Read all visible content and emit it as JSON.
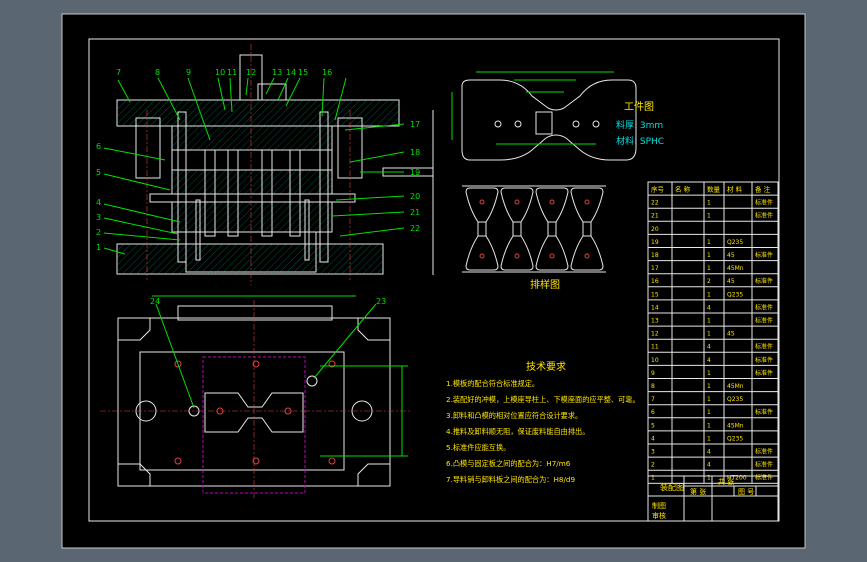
{
  "drawing": {
    "part_numbers_top": [
      "7",
      "8",
      "9",
      "10",
      "11",
      "12",
      "13",
      "14",
      "15",
      "16"
    ],
    "part_numbers_left": [
      "6",
      "5",
      "4",
      "3",
      "2",
      "1"
    ],
    "part_numbers_right": [
      "17",
      "18",
      "19",
      "20",
      "21",
      "22"
    ],
    "plan_view_labels": [
      "24",
      "23"
    ],
    "workpiece_title": "工件图",
    "workpiece_thickness": "料厚: 3mm",
    "workpiece_material": "材料: SPHC",
    "strip_layout_title": "排样图"
  },
  "tech_requirements": {
    "title": "技术要求",
    "lines": [
      "1.模板的配合符合标准规定。",
      "2.装配好的冲模，上模座导柱上、下模座面的应平整、可靠。",
      "3.卸料和凸模的相对位置应符合设计要求。",
      "4.推料及卸料顺无阻，保证废料能自由排出。",
      "5.标准件应能互换。",
      "6.凸模与固定板之间的配合为：H7/m6",
      "7.导料销与卸料板之间的配合为：H8/d9"
    ]
  },
  "title_block": {
    "drawing_name": "装配图",
    "cells": [
      "共 张",
      "第 张",
      "图 号",
      "制图",
      "审核"
    ]
  },
  "bom": {
    "headers": [
      "序号",
      "名 称",
      "数量",
      "材 料",
      "备 注"
    ],
    "rows": [
      [
        "22",
        "",
        "1",
        "",
        "标准件"
      ],
      [
        "21",
        "",
        "1",
        "",
        "标准件"
      ],
      [
        "20",
        "",
        "",
        "",
        ""
      ],
      [
        "19",
        "",
        "1",
        "Q235",
        ""
      ],
      [
        "18",
        "",
        "1",
        "45",
        "标准件"
      ],
      [
        "17",
        "",
        "1",
        "45Mn",
        ""
      ],
      [
        "16",
        "",
        "2",
        "45",
        "标准件"
      ],
      [
        "15",
        "",
        "1",
        "Q235",
        ""
      ],
      [
        "14",
        "",
        "4",
        "",
        "标准件"
      ],
      [
        "13",
        "",
        "1",
        "",
        "标准件"
      ],
      [
        "12",
        "",
        "1",
        "45",
        ""
      ],
      [
        "11",
        "",
        "4",
        "",
        "标准件"
      ],
      [
        "10",
        "",
        "4",
        "",
        "标准件"
      ],
      [
        "9",
        "",
        "1",
        "",
        "标准件"
      ],
      [
        "8",
        "",
        "1",
        "45Mn",
        ""
      ],
      [
        "7",
        "",
        "1",
        "Q235",
        ""
      ],
      [
        "6",
        "",
        "1",
        "",
        "标准件"
      ],
      [
        "5",
        "",
        "1",
        "45Mn",
        ""
      ],
      [
        "4",
        "",
        "1",
        "Q235",
        ""
      ],
      [
        "3",
        "",
        "4",
        "",
        "标准件"
      ],
      [
        "2",
        "",
        "4",
        "",
        "标准件"
      ],
      [
        "1",
        "",
        "1",
        "HT200",
        "标准件"
      ]
    ]
  }
}
